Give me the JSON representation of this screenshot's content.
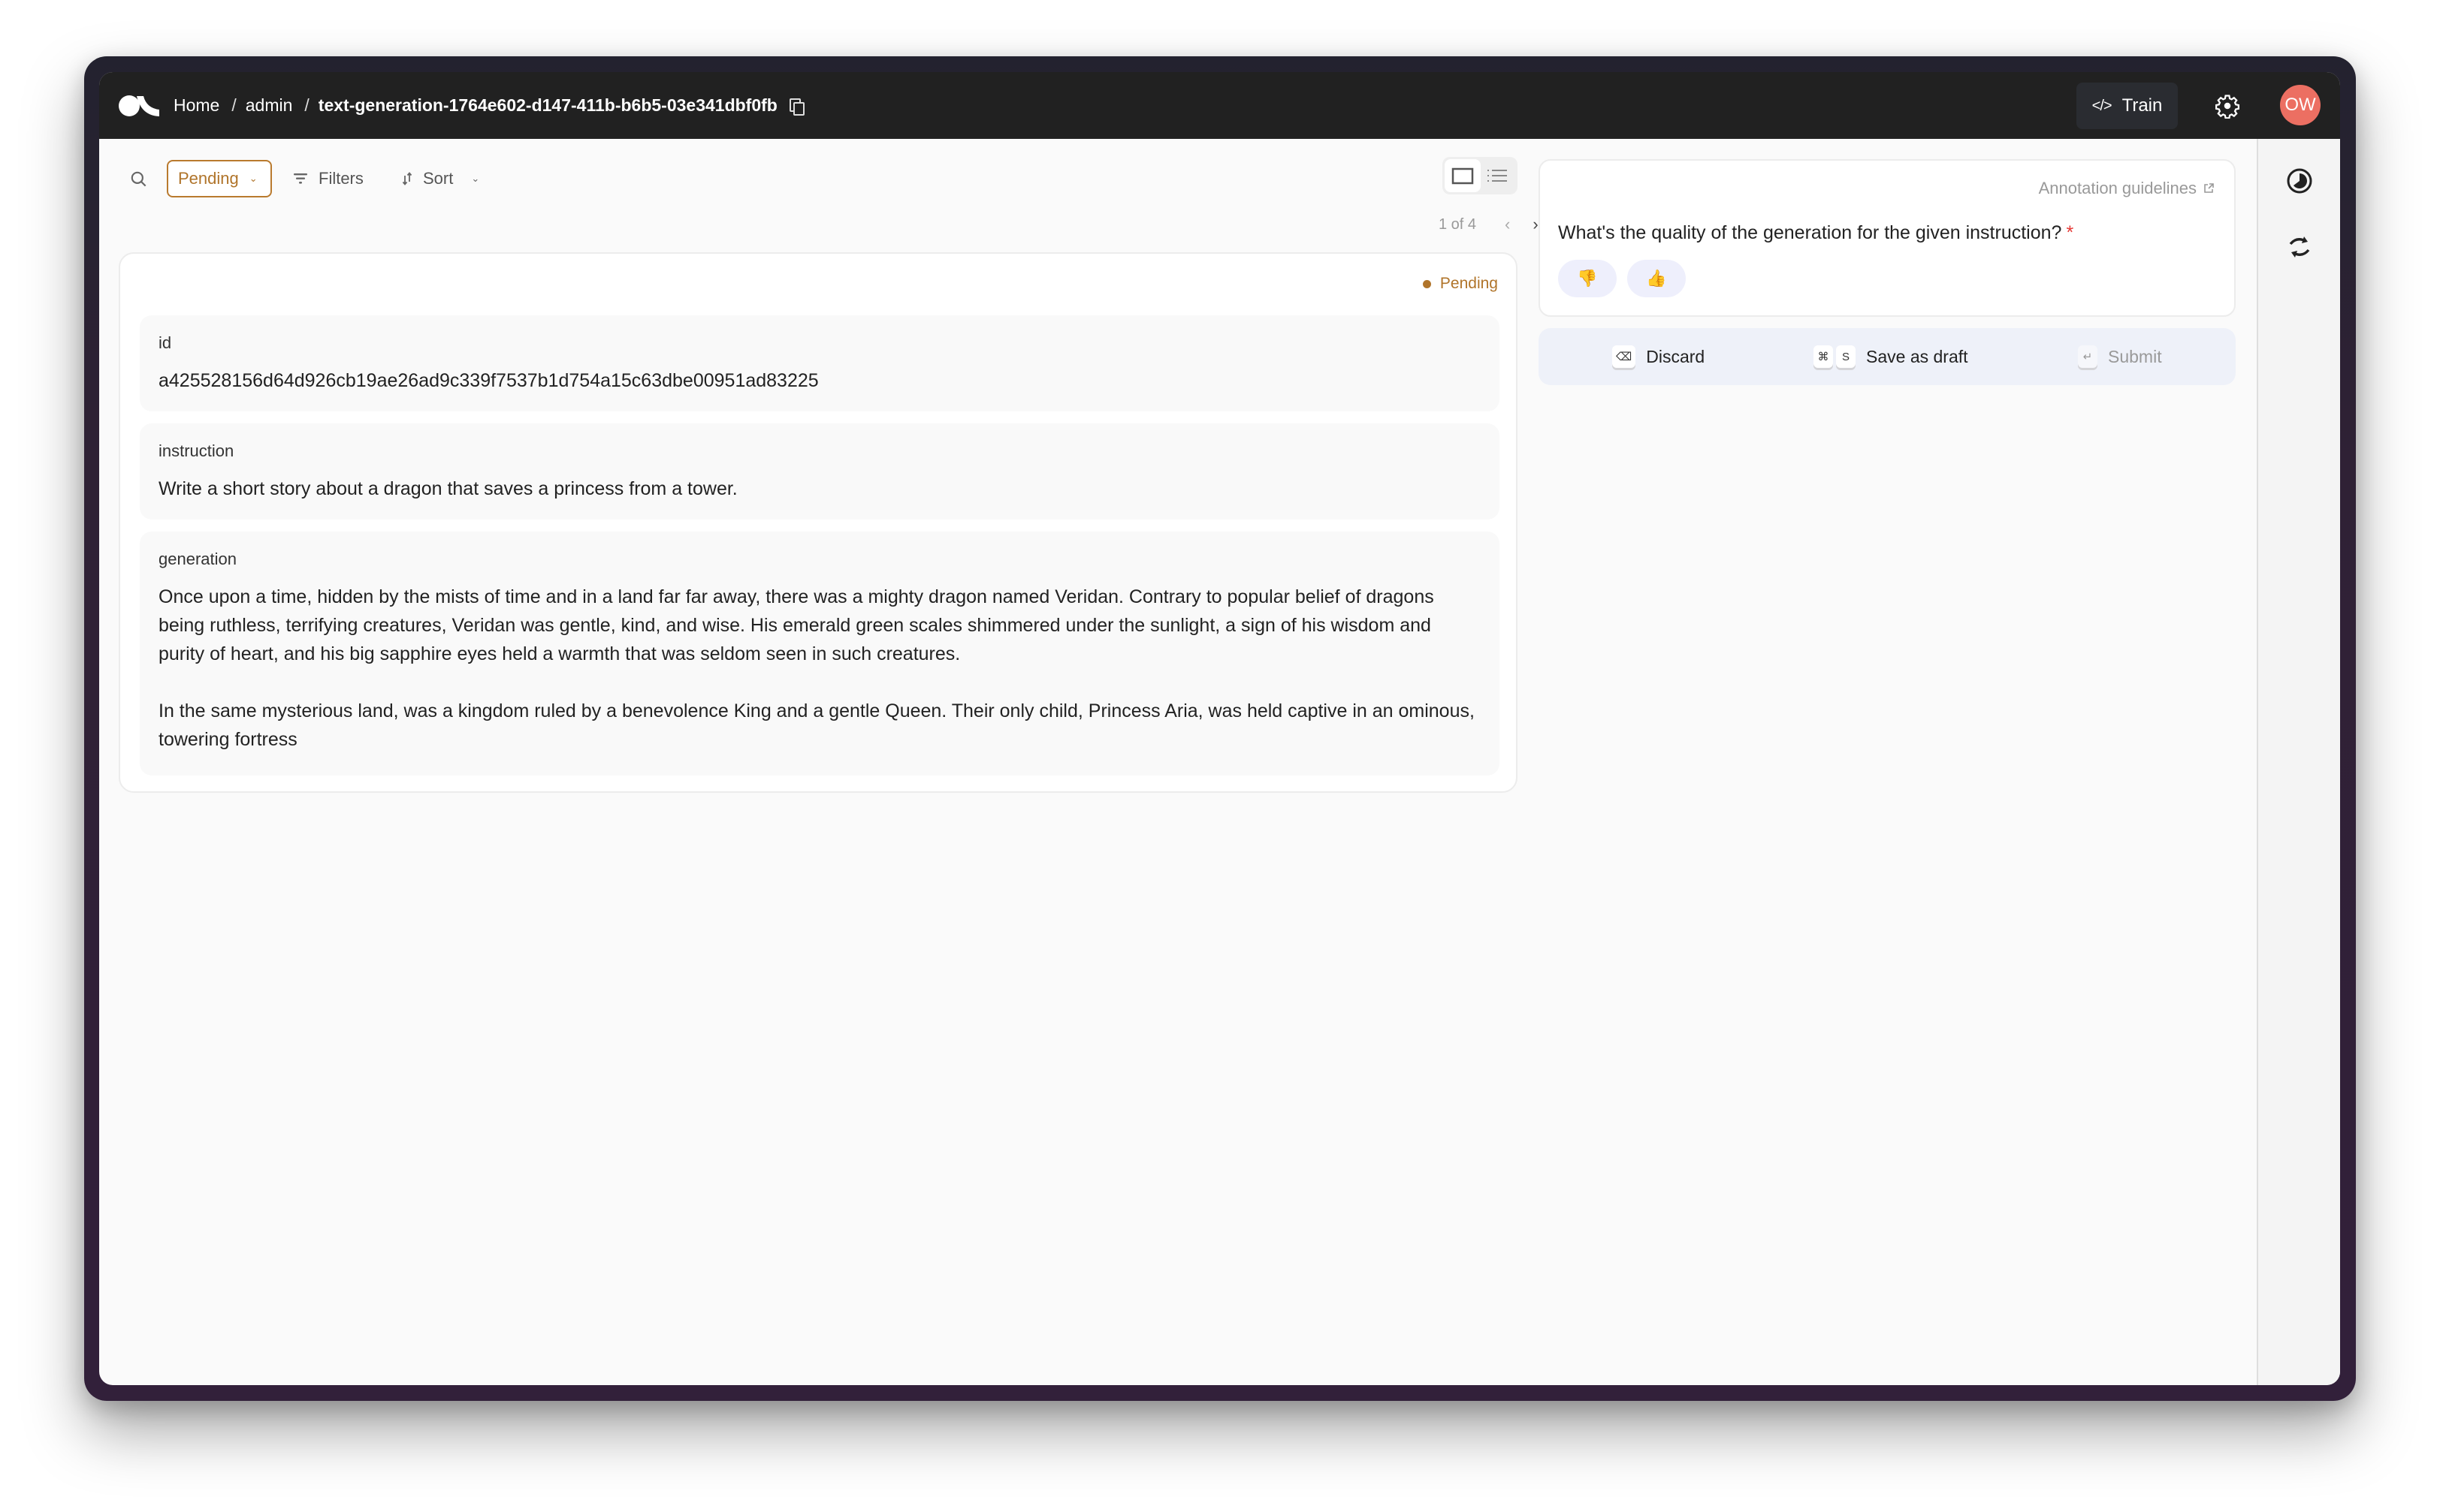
{
  "header": {
    "logo": "argilla-logo",
    "breadcrumb": [
      {
        "label": "Home"
      },
      {
        "label": "admin"
      },
      {
        "label": "text-generation-1764e602-d147-411b-b6b5-03e341dbf0fb"
      }
    ],
    "separator": "/",
    "copy_icon": "copy-icon",
    "train_label": "Train",
    "train_icon": "</>",
    "settings_icon": "gear-icon",
    "avatar_initials": "OW",
    "avatar_color": "#ec6f62"
  },
  "toolbar": {
    "search_icon": "search-icon",
    "status_filter": {
      "selected": "Pending",
      "color": "#b0742a"
    },
    "filters_label": "Filters",
    "sort_label": "Sort",
    "view_modes": [
      "single-record",
      "list"
    ],
    "active_view": "single-record"
  },
  "pagination": {
    "text": "1 of 4",
    "current": 1,
    "total": 4,
    "prev": "‹",
    "next": "›"
  },
  "record": {
    "status": "Pending",
    "fields": [
      {
        "label": "id",
        "value": "a425528156d64d926cb19ae26ad9c339f7537b1d754a15c63dbe00951ad83225"
      },
      {
        "label": "instruction",
        "value": "Write a short story about a dragon that saves a princess from a tower."
      },
      {
        "label": "generation",
        "value": "Once upon a time, hidden by the mists of time and in a land far far away, there was a mighty dragon named Veridan. Contrary to popular belief of dragons being ruthless, terrifying creatures, Veridan was gentle, kind, and wise. His emerald green scales shimmered under the sunlight, a sign of his wisdom and purity of heart, and his big sapphire eyes held a warmth that was seldom seen in such creatures.\n\nIn the same mysterious land, was a kingdom ruled by a benevolence King and a gentle Queen. Their only child, Princess Aria, was held captive in an ominous, towering fortress"
      }
    ]
  },
  "annotation": {
    "guidelines_label": "Annotation guidelines",
    "question": "What's the quality of the generation for the given instruction?",
    "required_marker": "*",
    "options": [
      {
        "label": "👎",
        "name": "thumbs-down"
      },
      {
        "label": "👍",
        "name": "thumbs-up"
      }
    ]
  },
  "actions": {
    "discard": {
      "label": "Discard",
      "shortcut": [
        "⌫"
      ]
    },
    "save_draft": {
      "label": "Save as draft",
      "shortcut": [
        "⌘",
        "S"
      ]
    },
    "submit": {
      "label": "Submit",
      "shortcut": [
        "↵"
      ],
      "disabled": true
    }
  },
  "sidebar": {
    "items": [
      {
        "icon": "history-icon",
        "name": "progress"
      },
      {
        "icon": "refresh-icon",
        "name": "refresh"
      }
    ],
    "shortcuts_icon": "⌘"
  }
}
